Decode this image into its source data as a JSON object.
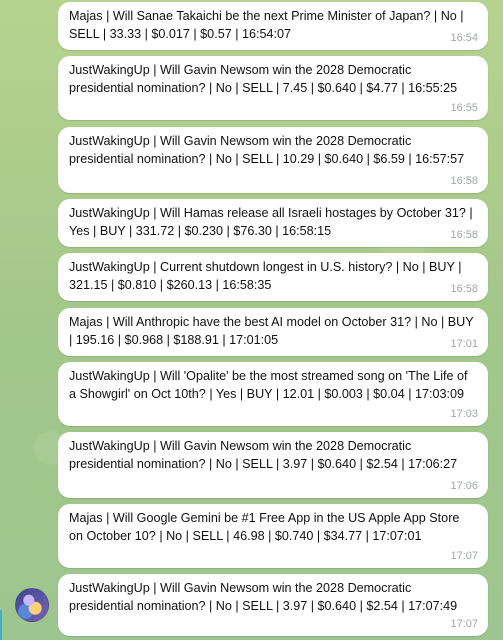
{
  "messages": [
    {
      "text": "Majas | Will Sanae Takaichi be the next Prime Minister of Japan? | No | SELL | 33.33 | $0.017 | $0.57 | 16:54:07",
      "time": "16:54"
    },
    {
      "text": "JustWakingUp | Will Gavin Newsom win the 2028 Democratic presidential nomination? | No | SELL | 7.45 | $0.640 | $4.77 | 16:55:25",
      "time": "16:55"
    },
    {
      "text": "JustWakingUp | Will Gavin Newsom win the 2028 Democratic presidential nomination? | No | SELL | 10.29 | $0.640 | $6.59 | 16:57:57",
      "time": "16:58"
    },
    {
      "text": "JustWakingUp | Will Hamas release all Israeli hostages by October 31? | Yes | BUY | 331.72 | $0.230 | $76.30 | 16:58:15",
      "time": "16:58"
    },
    {
      "text": "JustWakingUp | Current shutdown longest  in U.S. history? | No | BUY | 321.15 | $0.810 | $260.13 | 16:58:35",
      "time": "16:58"
    },
    {
      "text": "Majas | Will Anthropic have the best AI model on October 31? | No | BUY | 195.16 | $0.968 | $188.91 | 17:01:05",
      "time": "17:01"
    },
    {
      "text": "JustWakingUp | Will 'Opalite' be the most streamed song on 'The Life of a Showgirl' on Oct 10th? | Yes | BUY | 12.01 | $0.003 | $0.04 | 17:03:09",
      "time": "17:03"
    },
    {
      "text": "JustWakingUp | Will Gavin Newsom win the 2028 Democratic presidential nomination? | No | SELL | 3.97 | $0.640 | $2.54 | 17:06:27",
      "time": "17:06"
    },
    {
      "text": "Majas | Will Google Gemini be #1 Free App in the US Apple App Store on October 10? | No | SELL | 46.98 | $0.740 | $34.77 | 17:07:01",
      "time": "17:07"
    },
    {
      "text": "JustWakingUp | Will Gavin Newsom win the 2028 Democratic presidential nomination? | No | SELL | 3.97 | $0.640 | $2.54 | 17:07:49",
      "time": "17:07"
    }
  ],
  "avatar": {
    "icon": "bot-avatar-icon"
  }
}
